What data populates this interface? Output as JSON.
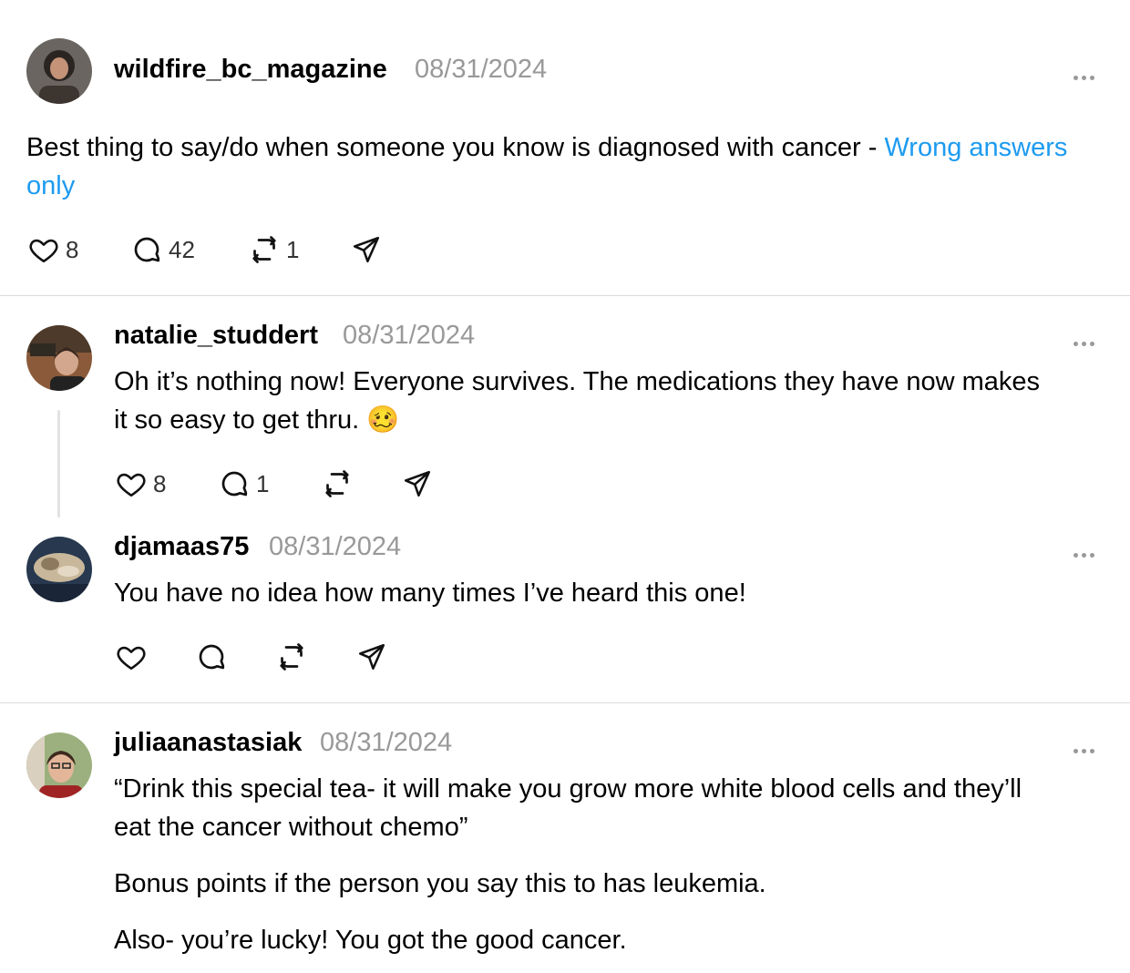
{
  "colors": {
    "link": "#1d9bf0",
    "date": "#999999",
    "divider": "#dcdcdc"
  },
  "posts": [
    {
      "username": "wildfire_bc_magazine",
      "date": "08/31/2024",
      "text_plain": "Best thing to say/do when someone you know is diagnosed with cancer - ",
      "text_link": "Wrong answers only",
      "likes": "8",
      "replies": "42",
      "reposts": "1"
    },
    {
      "username": "natalie_studdert",
      "date": "08/31/2024",
      "text_line1": "Oh it’s nothing now! Everyone survives. The medications they have now makes",
      "text_line2": "it so easy to get thru. 🥴",
      "likes": "8",
      "replies": "1"
    },
    {
      "username": "djamaas75",
      "date": "08/31/2024",
      "text": "You have no idea how many times I’ve heard this one!"
    },
    {
      "username": "juliaanastasiak",
      "date": "08/31/2024",
      "para1_line1": "“Drink this special tea- it will make you grow more white blood cells and they’ll",
      "para1_line2": "eat the cancer without chemo”",
      "para2": "Bonus points if the person you say this to has leukemia.",
      "para3": "Also- you’re lucky! You got the good cancer."
    }
  ],
  "icons": {
    "like": "heart-icon",
    "reply": "speech-bubble-icon",
    "repost": "repost-arrows-icon",
    "share": "paper-plane-icon",
    "more": "ellipsis-icon"
  }
}
